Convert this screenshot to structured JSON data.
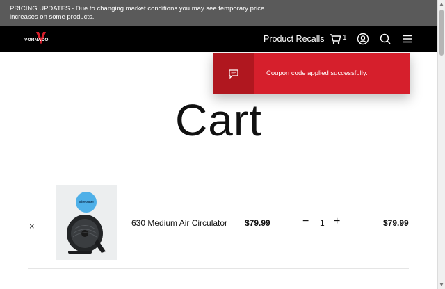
{
  "announcement": {
    "text": "PRICING UPDATES - Due to changing market conditions you may see temporary price increases on some products."
  },
  "header": {
    "logo_text": "VORNADO",
    "nav_link": "Product Recalls",
    "cart_count": "1",
    "icons": [
      "cart-icon",
      "account-icon",
      "search-icon",
      "menu-icon"
    ]
  },
  "toast": {
    "icon": "message-icon",
    "message": "Coupon code applied successfully.",
    "color": "#d61f2c"
  },
  "page": {
    "title": "Cart"
  },
  "cart": {
    "items": [
      {
        "remove_symbol": "×",
        "badge_text": "Wirecutter",
        "name": "630 Medium Air Circulator",
        "price": "$79.99",
        "qty_minus": "−",
        "quantity": "1",
        "qty_plus": "+",
        "subtotal": "$79.99"
      }
    ]
  }
}
